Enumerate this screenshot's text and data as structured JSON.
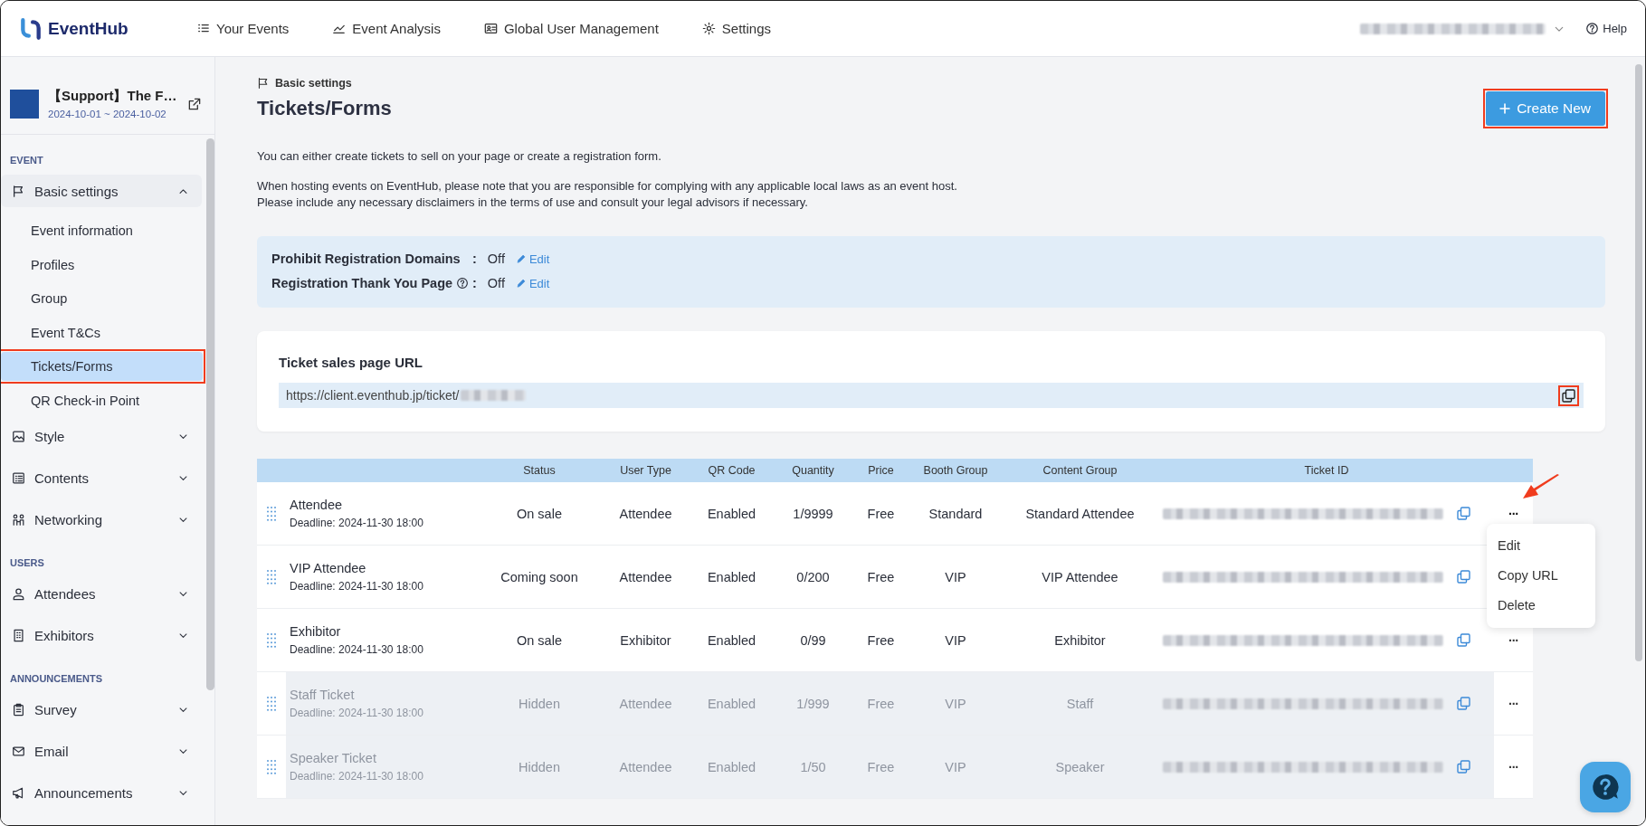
{
  "topbar": {
    "logo": "EventHub",
    "nav": [
      {
        "label": "Your Events"
      },
      {
        "label": "Event Analysis"
      },
      {
        "label": "Global User Management"
      },
      {
        "label": "Settings"
      }
    ],
    "help": "Help"
  },
  "sidebar": {
    "event": {
      "title": "【Support】The F…",
      "dates": "2024-10-01 ~ 2024-10-02"
    },
    "sections": [
      {
        "heading": "EVENT",
        "items": [
          {
            "label": "Basic settings",
            "expanded": true,
            "children": [
              {
                "label": "Event information",
                "selected": false
              },
              {
                "label": "Profiles",
                "selected": false
              },
              {
                "label": "Group",
                "selected": false
              },
              {
                "label": "Event T&Cs",
                "selected": false
              },
              {
                "label": "Tickets/Forms",
                "selected": true
              },
              {
                "label": "QR Check-in Point",
                "selected": false
              }
            ]
          },
          {
            "label": "Style",
            "expanded": false
          },
          {
            "label": "Contents",
            "expanded": false
          },
          {
            "label": "Networking",
            "expanded": false
          }
        ]
      },
      {
        "heading": "USERS",
        "items": [
          {
            "label": "Attendees",
            "expanded": false
          },
          {
            "label": "Exhibitors",
            "expanded": false
          }
        ]
      },
      {
        "heading": "ANNOUNCEMENTS",
        "items": [
          {
            "label": "Survey",
            "expanded": false
          },
          {
            "label": "Email",
            "expanded": false
          },
          {
            "label": "Announcements",
            "expanded": false
          }
        ]
      }
    ]
  },
  "page": {
    "breadcrumb": "Basic settings",
    "title": "Tickets/Forms",
    "create_button": "Create New",
    "intro": "You can either create tickets to sell on your page or create a registration form.",
    "notice": [
      "When hosting events on EventHub, please note that you are responsible for complying with any applicable local laws as an event host.",
      "Please include any necessary disclaimers in the terms of use and consult your legal advisors if necessary."
    ],
    "settings": [
      {
        "label": "Prohibit Registration Domains",
        "separator": ":",
        "value": "Off",
        "edit": "Edit"
      },
      {
        "label": "Registration Thank You Page",
        "separator": ":",
        "value": "Off",
        "edit": "Edit"
      }
    ],
    "url_card": {
      "title": "Ticket sales page URL",
      "url": "https://client.eventhub.jp/ticket/"
    }
  },
  "table": {
    "columns": [
      "",
      "Status",
      "User Type",
      "QR Code",
      "Quantity",
      "Price",
      "Booth Group",
      "Content Group",
      "Ticket ID"
    ],
    "rows": [
      {
        "name": "Attendee",
        "deadline": "Deadline: 2024-11-30 18:00",
        "status": "On sale",
        "user_type": "Attendee",
        "qr_code": "Enabled",
        "quantity": "1/9999",
        "price": "Free",
        "booth_group": "Standard",
        "content_group": "Standard Attendee",
        "dimmed": false,
        "more": "···",
        "menu_open": true
      },
      {
        "name": "VIP Attendee",
        "deadline": "Deadline: 2024-11-30 18:00",
        "status": "Coming soon",
        "user_type": "Attendee",
        "qr_code": "Enabled",
        "quantity": "0/200",
        "price": "Free",
        "booth_group": "VIP",
        "content_group": "VIP Attendee",
        "dimmed": false,
        "menu_open": false
      },
      {
        "name": "Exhibitor",
        "deadline": "Deadline: 2024-11-30 18:00",
        "status": "On sale",
        "user_type": "Exhibitor",
        "qr_code": "Enabled",
        "quantity": "0/99",
        "price": "Free",
        "booth_group": "VIP",
        "content_group": "Exhibitor",
        "dimmed": false,
        "more": "···",
        "menu_open": false
      },
      {
        "name": "Staff Ticket",
        "deadline": "Deadline: 2024-11-30 18:00",
        "status": "Hidden",
        "user_type": "Attendee",
        "qr_code": "Enabled",
        "quantity": "1/999",
        "price": "Free",
        "booth_group": "VIP",
        "content_group": "Staff",
        "dimmed": true,
        "more": "···",
        "menu_open": false
      },
      {
        "name": "Speaker Ticket",
        "deadline": "Deadline: 2024-11-30 18:00",
        "status": "Hidden",
        "user_type": "Attendee",
        "qr_code": "Enabled",
        "quantity": "1/50",
        "price": "Free",
        "booth_group": "VIP",
        "content_group": "Speaker",
        "dimmed": true,
        "more": "···",
        "menu_open": false
      }
    ],
    "row_menu": {
      "items": [
        "Edit",
        "Copy URL",
        "Delete"
      ]
    }
  }
}
